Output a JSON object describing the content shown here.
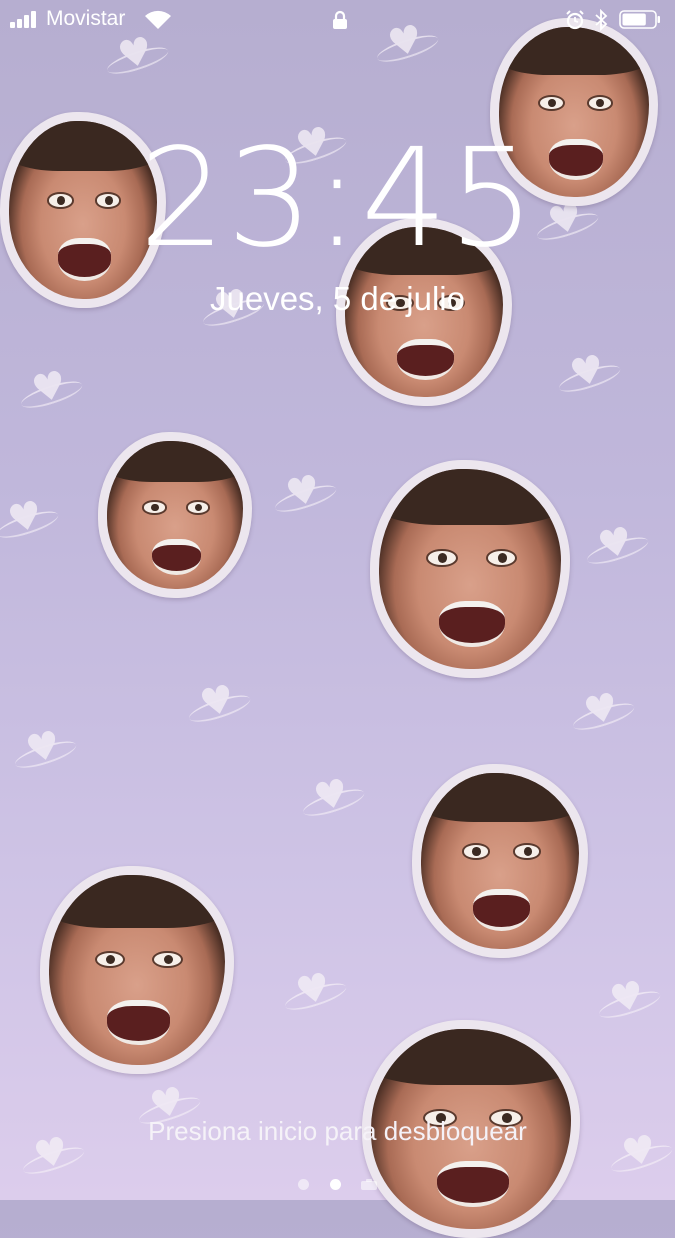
{
  "status_bar": {
    "carrier": "Movistar",
    "signal_bars": 4,
    "wifi_icon": "wifi-icon",
    "lock_icon": "lock-icon",
    "alarm_icon": "alarm-icon",
    "bluetooth_icon": "bluetooth-icon",
    "battery_level": 0.75
  },
  "lock_screen": {
    "time": "23:45",
    "date": "Jueves, 5 de julio",
    "unlock_hint": "Presiona inicio para desbloquear",
    "pages": 3,
    "active_page": 2
  },
  "wallpaper": {
    "background_top": "#b6aed0",
    "background_bottom": "#dccdec",
    "pattern": "hearts-and-face-stickers"
  }
}
